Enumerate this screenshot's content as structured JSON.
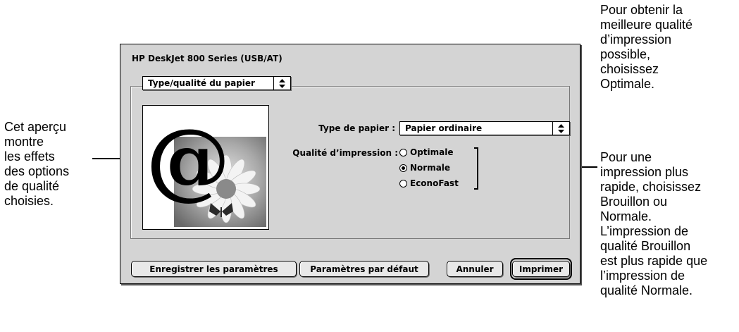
{
  "callouts": {
    "left": [
      "Cet aperçu",
      "montre",
      "les effets",
      "des options",
      "de qualité",
      "choisies."
    ],
    "top_right": [
      "Pour obtenir la",
      "meilleure qualité",
      "d’impression",
      "possible,",
      "choisissez",
      "Optimale."
    ],
    "right": [
      "Pour une",
      "impression plus",
      "rapide, choisissez",
      "Brouillon ou",
      "Normale.",
      "L’impression de",
      "qualité Brouillon",
      "est plus rapide que",
      "l’impression de",
      "qualité Normale."
    ]
  },
  "dialog": {
    "title": "HP DeskJet 800 Series (USB/AT)",
    "panel_menu": "Type/qualité du papier",
    "paper_type_label": "Type de papier :",
    "paper_type_value": "Papier ordinaire",
    "quality_label": "Qualité d’impression :",
    "quality_options": [
      {
        "label": "Optimale",
        "selected": false
      },
      {
        "label": "Normale",
        "selected": true
      },
      {
        "label": "EconoFast",
        "selected": false
      }
    ],
    "preview_glyph": "@",
    "buttons": {
      "save": "Enregistrer les paramètres",
      "defaults": "Paramètres par défaut",
      "cancel": "Annuler",
      "print": "Imprimer"
    }
  }
}
